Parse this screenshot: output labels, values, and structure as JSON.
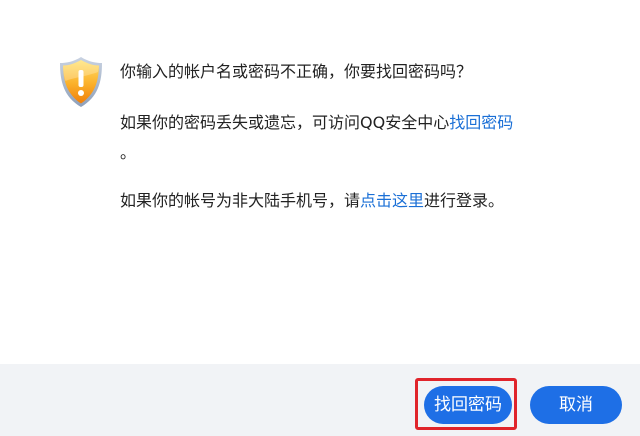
{
  "message": {
    "title": "你输入的帐户名或密码不正确，你要找回密码吗？",
    "line2_prefix": "如果你的密码丢失或遗忘，可访问QQ安全中心",
    "line2_link": "找回密码",
    "line2_suffix": "。",
    "line3_prefix": "如果你的帐号为非大陆手机号，请",
    "line3_link": "点击这里",
    "line3_suffix": "进行登录。"
  },
  "buttons": {
    "find_password": "找回密码",
    "cancel": "取消"
  },
  "icons": {
    "warning": "warning-shield-icon"
  },
  "colors": {
    "link": "#1a6fd6",
    "primary_button": "#1e6fe6",
    "highlight": "#e0242b",
    "shield_top": "#ffd34a",
    "shield_bottom": "#f28a0d"
  }
}
